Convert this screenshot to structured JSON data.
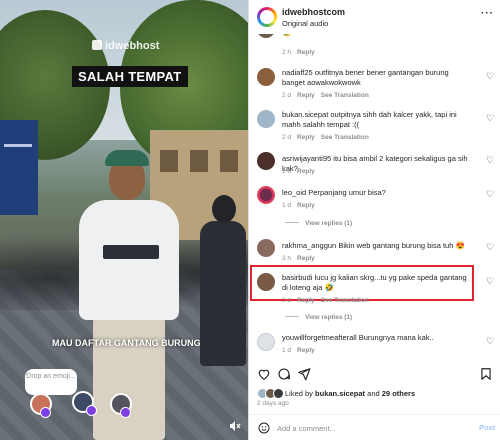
{
  "video": {
    "watermark": "idwebhost",
    "title_tag": "SALAH TEMPAT",
    "caption": "MAU DAFTAR GANTANG BURUNG",
    "emoji_prompt": "Drop an emoji...",
    "mute_icon": "speaker-muted-icon"
  },
  "header": {
    "username": "idwebhostcom",
    "subtitle": "Original audio",
    "more_icon": "more-horizontal-icon"
  },
  "comments": [
    {
      "username": "",
      "text": "😢",
      "time": "2 h",
      "reply": "Reply",
      "translate": ""
    },
    {
      "username": "nadiaff25",
      "text": "outfitnya bener bener gantangan burung banget aowakwokwowk",
      "time": "2 d",
      "reply": "Reply",
      "translate": "See Translation"
    },
    {
      "username": "bukan.sicepat",
      "text": "outpitnya sihh dah kalcer yakk, tapi ini mahh salahh tempat :((",
      "time": "2 d",
      "reply": "Reply",
      "translate": "See Translation"
    },
    {
      "username": "asriwijayanti95",
      "text": "itu bisa ambil 2 kategori sekaligus ga sih kak?",
      "time": "1 d",
      "reply": "Reply",
      "translate": ""
    },
    {
      "username": "leo_oid",
      "text": "Perpanjang umur bisa?",
      "time": "1 d",
      "reply": "Reply",
      "translate": ""
    },
    {
      "username": "rakhma_anggun",
      "text": "Bikin web gantang burung bisa tuh 😍",
      "time": "3 h",
      "reply": "Reply",
      "translate": ""
    },
    {
      "username": "basirbudi",
      "text": "lucu jg kalian skrg...tu yg pake speda gantang di loteng aja 🤣",
      "time": "2 d",
      "reply": "Reply",
      "translate": "See Translation"
    },
    {
      "username": "youwillforgetmeafterall",
      "text": "Burungnya mana kak..",
      "time": "1 d",
      "reply": "Reply",
      "translate": ""
    }
  ],
  "view_replies": [
    "View replies (1)",
    "View replies (1)"
  ],
  "actions": {
    "like_icon": "heart-icon",
    "comment_icon": "comment-icon",
    "share_icon": "share-icon",
    "save_icon": "bookmark-icon"
  },
  "likes": {
    "prefix": "Liked by",
    "user": "bukan.sicepat",
    "middle": "and",
    "others": "29 others"
  },
  "date": "2 days ago",
  "add_comment": {
    "placeholder": "Add a comment...",
    "post_label": "Post"
  },
  "colors": {
    "highlight": "#e0232e",
    "link_blue": "#a6c8f5",
    "muted_text": "#8e8e8e"
  }
}
